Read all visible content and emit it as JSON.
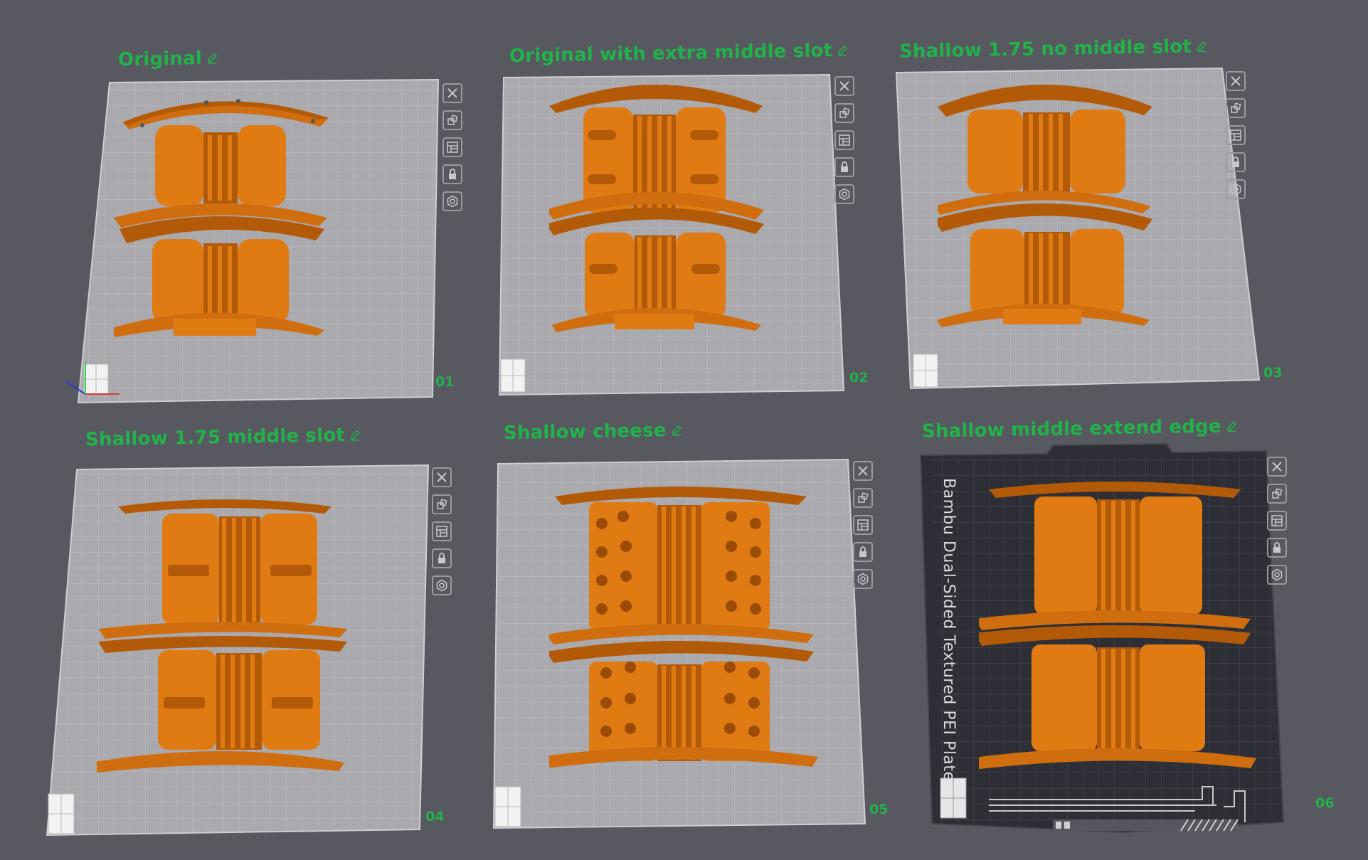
{
  "plates": [
    {
      "title": "Original",
      "number": "01",
      "variant": "original"
    },
    {
      "title": "Original with extra middle slot",
      "number": "02",
      "variant": "extra-slot"
    },
    {
      "title": "Shallow 1.75 no middle slot",
      "number": "03",
      "variant": "shallow-no-slot"
    },
    {
      "title": "Shallow 1.75 middle slot",
      "number": "04",
      "variant": "shallow-slot"
    },
    {
      "title": "Shallow cheese",
      "number": "05",
      "variant": "cheese"
    },
    {
      "title": "Shallow middle extend edge",
      "number": "06",
      "variant": "extend-edge",
      "bed_label": "Bambu Dual-Sided Textured PEI Plate"
    }
  ],
  "toolbar_icons": [
    "close-icon",
    "arrange-icon",
    "layout-icon",
    "lock-icon",
    "settings-icon"
  ],
  "colors": {
    "background": "#585860",
    "bed_grey": "#a9a9ae",
    "bed_dark": "#2e2f36",
    "part_orange": "#e07a12",
    "title_green": "#21b24a"
  }
}
